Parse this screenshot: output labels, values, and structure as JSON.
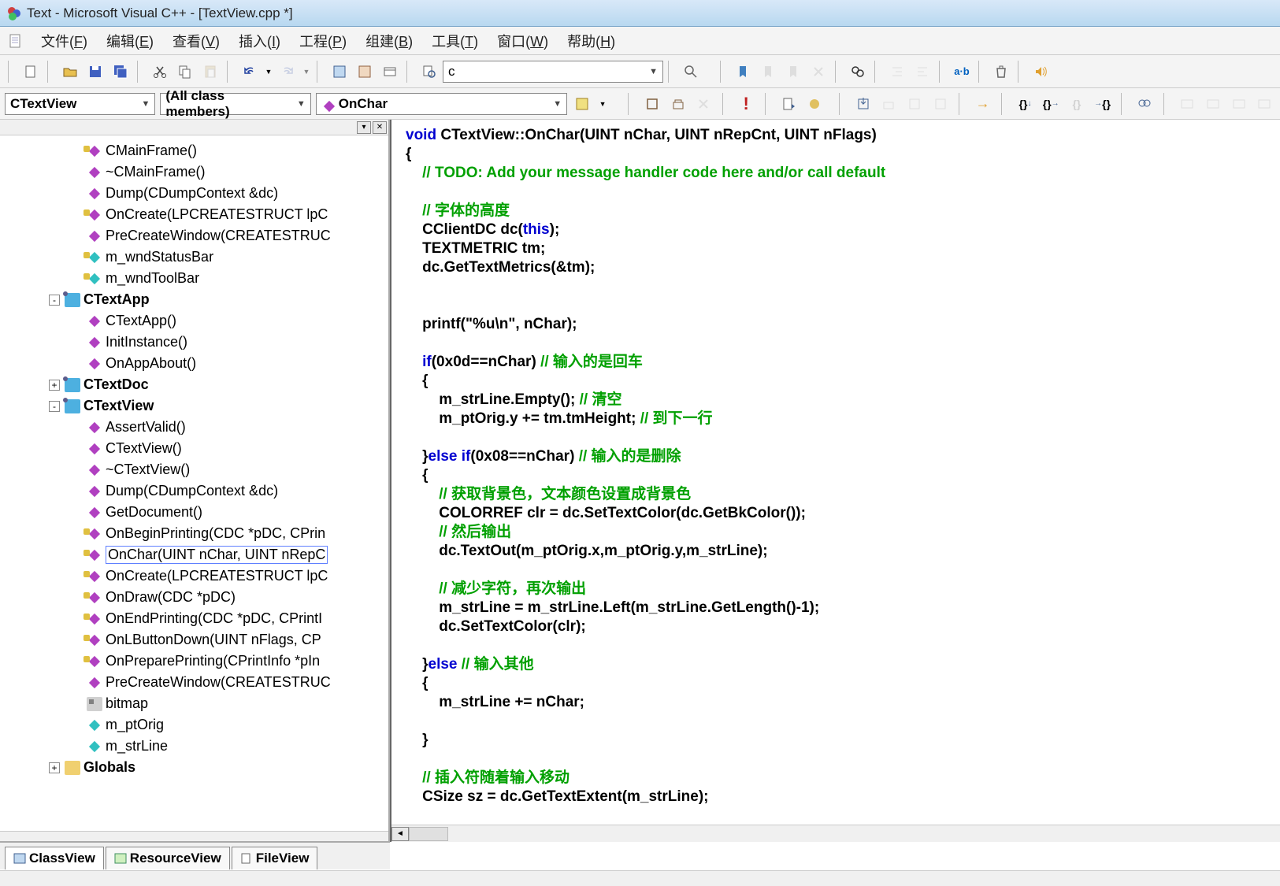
{
  "title": "Text - Microsoft Visual C++ - [TextView.cpp *]",
  "menu": [
    "文件(F)",
    "编辑(E)",
    "查看(V)",
    "插入(I)",
    "工程(P)",
    "组建(B)",
    "工具(T)",
    "窗口(W)",
    "帮助(H)"
  ],
  "find_value": "c",
  "combos": {
    "class": "CTextView",
    "members": "(All class members)",
    "function": "OnChar"
  },
  "tree": [
    {
      "d": 3,
      "t": "fp",
      "l": "CMainFrame()"
    },
    {
      "d": 3,
      "t": "f",
      "l": "~CMainFrame()"
    },
    {
      "d": 3,
      "t": "f",
      "l": "Dump(CDumpContext &dc)"
    },
    {
      "d": 3,
      "t": "fp",
      "l": "OnCreate(LPCREATESTRUCT lpC"
    },
    {
      "d": 3,
      "t": "f",
      "l": "PreCreateWindow(CREATESTRUC"
    },
    {
      "d": 3,
      "t": "vp",
      "l": "m_wndStatusBar"
    },
    {
      "d": 3,
      "t": "vp",
      "l": "m_wndToolBar"
    },
    {
      "d": 2,
      "t": "cls",
      "e": "-",
      "l": "CTextApp"
    },
    {
      "d": 3,
      "t": "f",
      "l": "CTextApp()"
    },
    {
      "d": 3,
      "t": "f",
      "l": "InitInstance()"
    },
    {
      "d": 3,
      "t": "f",
      "l": "OnAppAbout()"
    },
    {
      "d": 2,
      "t": "cls",
      "e": "+",
      "l": "CTextDoc"
    },
    {
      "d": 2,
      "t": "cls",
      "e": "-",
      "l": "CTextView"
    },
    {
      "d": 3,
      "t": "f",
      "l": "AssertValid()"
    },
    {
      "d": 3,
      "t": "f",
      "l": "CTextView()"
    },
    {
      "d": 3,
      "t": "f",
      "l": "~CTextView()"
    },
    {
      "d": 3,
      "t": "f",
      "l": "Dump(CDumpContext &dc)"
    },
    {
      "d": 3,
      "t": "f",
      "l": "GetDocument()"
    },
    {
      "d": 3,
      "t": "fp",
      "l": "OnBeginPrinting(CDC *pDC, CPrin"
    },
    {
      "d": 3,
      "t": "fp",
      "l": "OnChar(UINT nChar, UINT nRepC",
      "sel": true
    },
    {
      "d": 3,
      "t": "fp",
      "l": "OnCreate(LPCREATESTRUCT lpC"
    },
    {
      "d": 3,
      "t": "fp",
      "l": "OnDraw(CDC *pDC)"
    },
    {
      "d": 3,
      "t": "fp",
      "l": "OnEndPrinting(CDC *pDC, CPrintI"
    },
    {
      "d": 3,
      "t": "fp",
      "l": "OnLButtonDown(UINT nFlags, CP"
    },
    {
      "d": 3,
      "t": "fp",
      "l": "OnPreparePrinting(CPrintInfo *pIn"
    },
    {
      "d": 3,
      "t": "f",
      "l": "PreCreateWindow(CREATESTRUC"
    },
    {
      "d": 3,
      "t": "bmp",
      "l": "bitmap"
    },
    {
      "d": 3,
      "t": "v",
      "l": "m_ptOrig"
    },
    {
      "d": 3,
      "t": "v",
      "l": "m_strLine"
    },
    {
      "d": 2,
      "t": "fld",
      "e": "+",
      "l": "Globals"
    }
  ],
  "tabs": {
    "class": "ClassView",
    "resource": "ResourceView",
    "file": "FileView"
  },
  "status": "",
  "code_lines": [
    {
      "seg": [
        {
          "c": "kw",
          "t": "void"
        },
        {
          "t": " CTextView::OnChar(UINT nChar, UINT nRepCnt, UINT nFlags)"
        }
      ]
    },
    {
      "seg": [
        {
          "t": "{"
        }
      ]
    },
    {
      "seg": [
        {
          "t": "    "
        },
        {
          "c": "cm",
          "t": "// TODO: Add your message handler code here and/or call default"
        }
      ]
    },
    {
      "seg": [
        {
          "t": ""
        }
      ]
    },
    {
      "seg": [
        {
          "t": "    "
        },
        {
          "c": "cm",
          "t": "// 字体的高度"
        }
      ]
    },
    {
      "seg": [
        {
          "t": "    CClientDC dc("
        },
        {
          "c": "kw",
          "t": "this"
        },
        {
          "t": ");"
        }
      ]
    },
    {
      "seg": [
        {
          "t": "    TEXTMETRIC tm;"
        }
      ]
    },
    {
      "seg": [
        {
          "t": "    dc.GetTextMetrics(&tm);"
        }
      ]
    },
    {
      "seg": [
        {
          "t": ""
        }
      ]
    },
    {
      "seg": [
        {
          "t": ""
        }
      ]
    },
    {
      "seg": [
        {
          "t": "    printf(\"%u\\n\", nChar);"
        }
      ]
    },
    {
      "seg": [
        {
          "t": ""
        }
      ]
    },
    {
      "seg": [
        {
          "t": "    "
        },
        {
          "c": "kw",
          "t": "if"
        },
        {
          "t": "(0x0d==nChar) "
        },
        {
          "c": "cm",
          "t": "// 输入的是回车"
        }
      ]
    },
    {
      "seg": [
        {
          "t": "    {"
        }
      ]
    },
    {
      "seg": [
        {
          "t": "        m_strLine.Empty(); "
        },
        {
          "c": "cm",
          "t": "// 清空"
        }
      ]
    },
    {
      "seg": [
        {
          "t": "        m_ptOrig.y += tm.tmHeight; "
        },
        {
          "c": "cm",
          "t": "// 到下一行"
        }
      ]
    },
    {
      "seg": [
        {
          "t": ""
        }
      ]
    },
    {
      "seg": [
        {
          "t": "    }"
        },
        {
          "c": "kw",
          "t": "else if"
        },
        {
          "t": "(0x08==nChar) "
        },
        {
          "c": "cm",
          "t": "// 输入的是删除"
        }
      ]
    },
    {
      "seg": [
        {
          "t": "    {"
        }
      ]
    },
    {
      "seg": [
        {
          "t": "        "
        },
        {
          "c": "cm",
          "t": "// 获取背景色，文本颜色设置成背景色"
        }
      ]
    },
    {
      "seg": [
        {
          "t": "        COLORREF clr = dc.SetTextColor(dc.GetBkColor());"
        }
      ]
    },
    {
      "seg": [
        {
          "t": "        "
        },
        {
          "c": "cm",
          "t": "// 然后输出"
        }
      ]
    },
    {
      "seg": [
        {
          "t": "        dc.TextOut(m_ptOrig.x,m_ptOrig.y,m_strLine);"
        }
      ]
    },
    {
      "seg": [
        {
          "t": ""
        }
      ]
    },
    {
      "seg": [
        {
          "t": "        "
        },
        {
          "c": "cm",
          "t": "// 减少字符，再次输出"
        }
      ]
    },
    {
      "seg": [
        {
          "t": "        m_strLine = m_strLine.Left(m_strLine.GetLength()-1);"
        }
      ]
    },
    {
      "seg": [
        {
          "t": "        dc.SetTextColor(clr);"
        }
      ]
    },
    {
      "seg": [
        {
          "t": ""
        }
      ]
    },
    {
      "seg": [
        {
          "t": "    }"
        },
        {
          "c": "kw",
          "t": "else"
        },
        {
          "t": " "
        },
        {
          "c": "cm",
          "t": "// 输入其他"
        }
      ]
    },
    {
      "seg": [
        {
          "t": "    {"
        }
      ]
    },
    {
      "seg": [
        {
          "t": "        m_strLine += nChar;"
        }
      ]
    },
    {
      "seg": [
        {
          "t": ""
        }
      ]
    },
    {
      "seg": [
        {
          "t": "    }"
        }
      ]
    },
    {
      "seg": [
        {
          "t": ""
        }
      ]
    },
    {
      "seg": [
        {
          "t": "    "
        },
        {
          "c": "cm",
          "t": "// 插入符随着输入移动"
        }
      ]
    },
    {
      "seg": [
        {
          "t": "    CSize sz = dc.GetTextExtent(m_strLine);"
        }
      ]
    }
  ]
}
